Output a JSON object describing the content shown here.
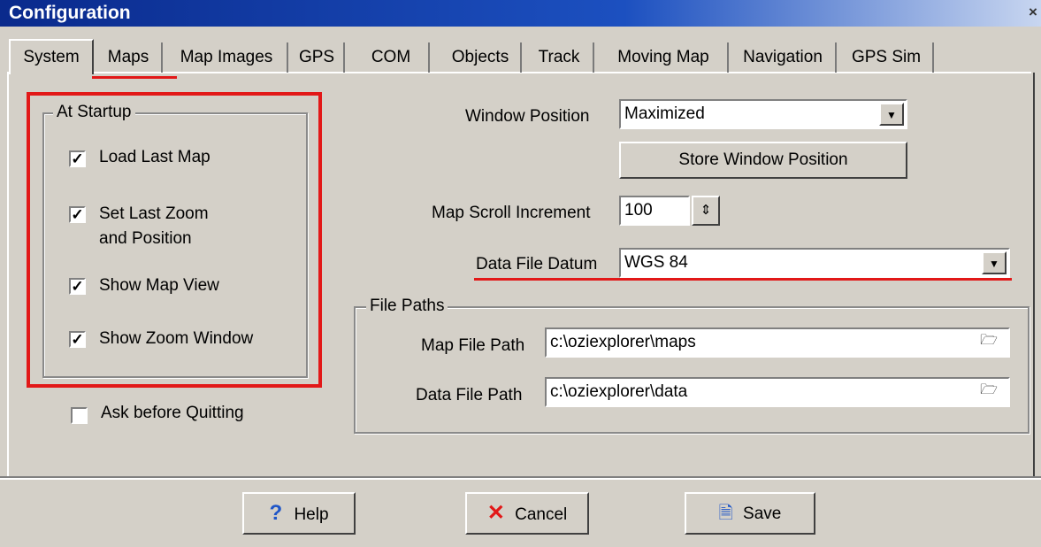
{
  "window": {
    "title": "Configuration"
  },
  "tabs": [
    "System",
    "Maps",
    "Map Images",
    "GPS",
    "COM",
    "Objects",
    "Track",
    "Moving Map",
    "Navigation",
    "GPS Sim"
  ],
  "startup": {
    "legend": "At Startup",
    "load_last_map": "Load Last Map",
    "set_last_zoom_line1": "Set Last Zoom",
    "set_last_zoom_line2": "and Position",
    "show_map_view": "Show Map View",
    "show_zoom_window": "Show Zoom Window",
    "ask_before_quitting": "Ask before Quitting"
  },
  "checks": {
    "load_last_map": true,
    "set_last_zoom": true,
    "show_map_view": true,
    "show_zoom_window": true,
    "ask_before_quitting": false
  },
  "window_position": {
    "label": "Window Position",
    "value": "Maximized",
    "store_button": "Store Window Position"
  },
  "scroll": {
    "label": "Map Scroll Increment",
    "value": "100"
  },
  "datum": {
    "label": "Data File Datum",
    "value": "WGS 84"
  },
  "file_paths": {
    "legend": "File Paths",
    "map_label": "Map File Path",
    "map_value": "c:\\oziexplorer\\maps",
    "data_label": "Data File Path",
    "data_value": "c:\\oziexplorer\\data"
  },
  "buttons": {
    "help": "Help",
    "cancel": "Cancel",
    "save": "Save"
  },
  "colors": {
    "highlight": "#e21818",
    "title_bar": "#0a2a8c",
    "dialog_bg": "#d4d0c8"
  }
}
